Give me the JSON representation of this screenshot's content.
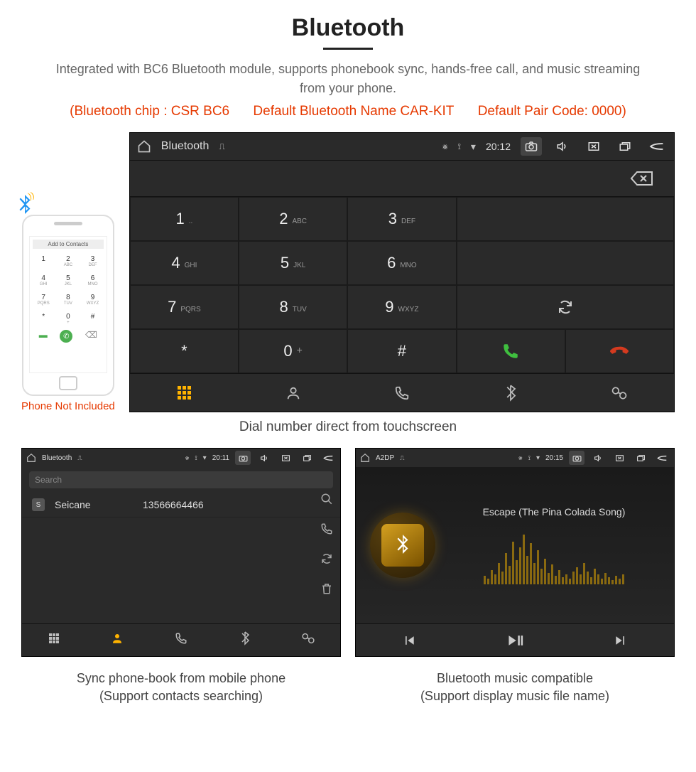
{
  "header": {
    "title": "Bluetooth",
    "desc": "Integrated with BC6 Bluetooth module, supports phonebook sync, hands-free call, and music streaming from your phone.",
    "red1": "(Bluetooth chip : CSR BC6",
    "red2": "Default Bluetooth Name CAR-KIT",
    "red3": "Default Pair Code: 0000)"
  },
  "phone": {
    "not_included": "Phone Not Included",
    "add": "Add to Contacts",
    "keys": [
      {
        "n": "1",
        "s": ""
      },
      {
        "n": "2",
        "s": "ABC"
      },
      {
        "n": "3",
        "s": "DEF"
      },
      {
        "n": "4",
        "s": "GHI"
      },
      {
        "n": "5",
        "s": "JKL"
      },
      {
        "n": "6",
        "s": "MNO"
      },
      {
        "n": "7",
        "s": "PQRS"
      },
      {
        "n": "8",
        "s": "TUV"
      },
      {
        "n": "9",
        "s": "WXYZ"
      },
      {
        "n": "*",
        "s": ""
      },
      {
        "n": "0",
        "s": "+"
      },
      {
        "n": "#",
        "s": ""
      }
    ]
  },
  "main_unit": {
    "status": {
      "title": "Bluetooth",
      "time": "20:12"
    },
    "keys": [
      {
        "n": "1",
        "s": ".."
      },
      {
        "n": "2",
        "s": "ABC"
      },
      {
        "n": "3",
        "s": "DEF"
      },
      {
        "n": "4",
        "s": "GHI"
      },
      {
        "n": "5",
        "s": "JKL"
      },
      {
        "n": "6",
        "s": "MNO"
      },
      {
        "n": "7",
        "s": "PQRS"
      },
      {
        "n": "8",
        "s": "TUV"
      },
      {
        "n": "9",
        "s": "WXYZ"
      },
      {
        "n": "*",
        "s": ""
      },
      {
        "n": "0",
        "s": "+"
      },
      {
        "n": "#",
        "s": ""
      }
    ],
    "caption": "Dial number direct from touchscreen"
  },
  "phonebook": {
    "status": {
      "title": "Bluetooth",
      "time": "20:11"
    },
    "search_ph": "Search",
    "contact": {
      "badge": "S",
      "name": "Seicane",
      "number": "13566664466"
    },
    "caption": "Sync phone-book from mobile phone",
    "caption2": "(Support contacts searching)"
  },
  "music": {
    "status": {
      "title": "A2DP",
      "time": "20:15"
    },
    "song": "Escape (The Pina Colada Song)",
    "caption": "Bluetooth music compatible",
    "caption2": "(Support display music file name)"
  },
  "colors": {
    "accent": "#ffb300",
    "red": "#e63900",
    "green": "#3fbf3f",
    "hang": "#d43a1f"
  }
}
